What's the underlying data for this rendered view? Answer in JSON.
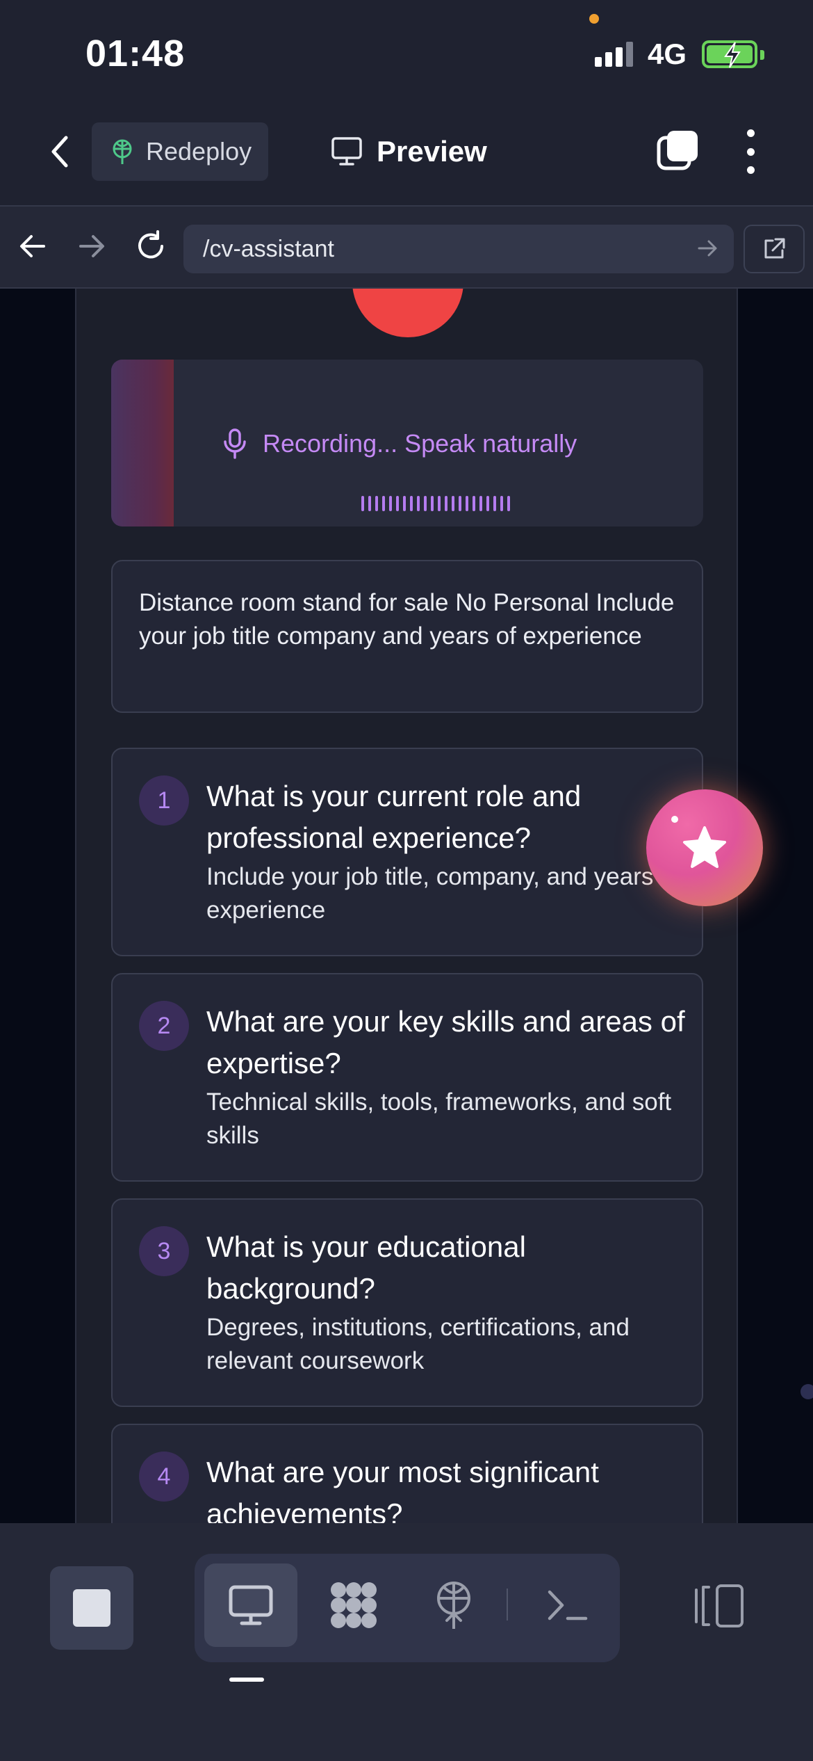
{
  "status_bar": {
    "time": "01:48",
    "network": "4G"
  },
  "header": {
    "redeploy_label": "Redeploy",
    "preview_label": "Preview"
  },
  "browser": {
    "url": "/cv-assistant"
  },
  "recording": {
    "label": "Recording... Speak naturally",
    "accent_color": "#c58af5"
  },
  "hint": {
    "text": "Distance room stand for sale No Personal Include your job title company and years of experience"
  },
  "questions": [
    {
      "number": "1",
      "title": "What is your current role and professional experience?",
      "description": "Include your job title, company, and years of experience"
    },
    {
      "number": "2",
      "title": "What are your key skills and areas of expertise?",
      "description": "Technical skills, tools, frameworks, and soft skills"
    },
    {
      "number": "3",
      "title": "What is your educational background?",
      "description": "Degrees, institutions, certifications, and relevant coursework"
    },
    {
      "number": "4",
      "title": "What are your most significant achievements?",
      "description": ""
    }
  ],
  "toolbar": {
    "icons": [
      "stop-icon",
      "desktop-preview-icon",
      "grid-dots-icon",
      "deploy-globe-icon",
      "terminal-icon",
      "side-panel-icon"
    ]
  }
}
